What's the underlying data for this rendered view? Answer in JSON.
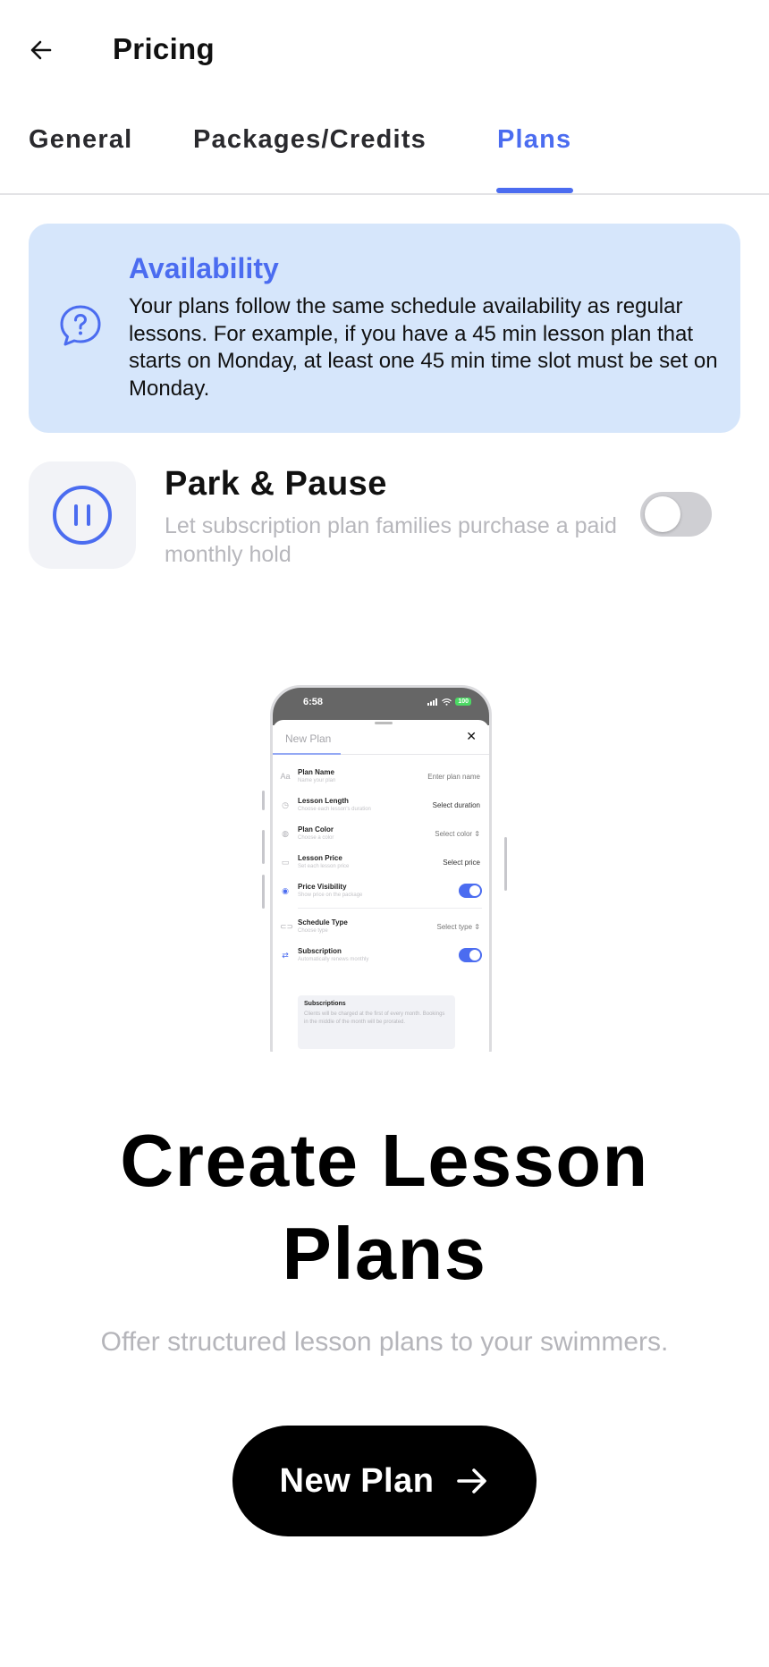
{
  "header": {
    "title": "Pricing"
  },
  "tabs": [
    {
      "label": "General",
      "active": false
    },
    {
      "label": "Packages/Credits",
      "active": false
    },
    {
      "label": "Plans",
      "active": true
    }
  ],
  "availability": {
    "title": "Availability",
    "text": "Your plans follow the same schedule availability as regular lessons. For example, if you have a 45 min lesson plan that starts on Monday, at least one 45 min time slot must be set on Monday."
  },
  "park_pause": {
    "title": "Park & Pause",
    "description": "Let subscription plan families purchase a paid monthly hold",
    "enabled": false
  },
  "mockup": {
    "time": "6:58",
    "battery": "100",
    "sheet_title": "New Plan",
    "rows": [
      {
        "label": "Plan Name",
        "sub": "Name your plan",
        "value": "Enter plan name"
      },
      {
        "label": "Lesson Length",
        "sub": "Choose each lesson's duration",
        "value": "Select duration"
      },
      {
        "label": "Plan Color",
        "sub": "Choose a color",
        "value": "Select color ⇕"
      },
      {
        "label": "Lesson Price",
        "sub": "Set each lesson price",
        "value": "Select price"
      },
      {
        "label": "Price Visibility",
        "sub": "Show price on the package",
        "toggle": true
      },
      {
        "label": "Schedule Type",
        "sub": "Choose type",
        "value": "Select type ⇕"
      },
      {
        "label": "Subscription",
        "sub": "Automatically renews monthly",
        "toggle": true
      }
    ],
    "note_title": "Subscriptions",
    "note_text": "Clients will be charged at the first of every month. Bookings in the middle of the month will be prorated."
  },
  "hero": {
    "title_line1": "Create Lesson",
    "title_line2": "Plans",
    "subtitle": "Offer structured lesson plans to your swimmers."
  },
  "cta": {
    "label": "New Plan"
  },
  "colors": {
    "accent": "#4b6cf0",
    "banner_bg": "#d6e6fb",
    "cta_bg": "#000000"
  }
}
